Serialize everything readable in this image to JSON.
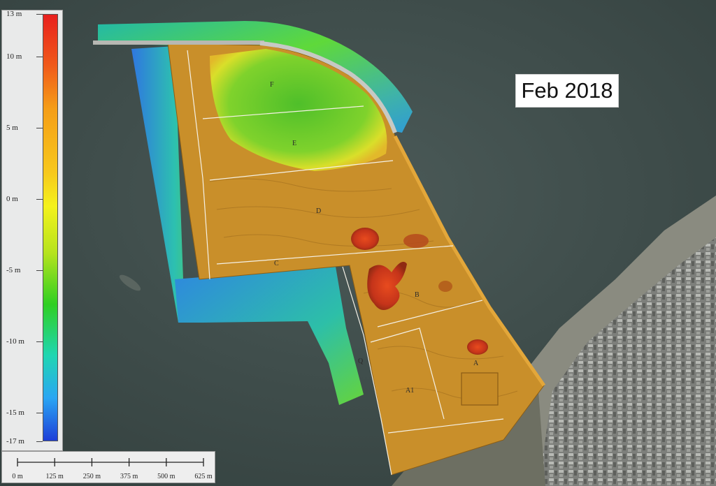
{
  "legend": {
    "title": "",
    "ticks": [
      {
        "label": "13 m",
        "value": 13
      },
      {
        "label": "10 m",
        "value": 10
      },
      {
        "label": "5 m",
        "value": 5
      },
      {
        "label": "0 m",
        "value": 0
      },
      {
        "label": "-5 m",
        "value": -5
      },
      {
        "label": "-10 m",
        "value": -10
      },
      {
        "label": "-15 m",
        "value": -15
      },
      {
        "label": "-17 m",
        "value": -17
      }
    ]
  },
  "date_label": "Feb 2018",
  "scale_bar": {
    "labels": [
      "0 m",
      "125 m",
      "250 m",
      "375 m",
      "500 m",
      "625 m"
    ]
  },
  "zones": [
    {
      "id": "F",
      "label": "F"
    },
    {
      "id": "E",
      "label": "E"
    },
    {
      "id": "D",
      "label": "D"
    },
    {
      "id": "C",
      "label": "C"
    },
    {
      "id": "B",
      "label": "B"
    },
    {
      "id": "A",
      "label": "A"
    },
    {
      "id": "A1",
      "label": "A1"
    },
    {
      "id": "Q",
      "label": "Q"
    }
  ],
  "colors": {
    "sea": "#3f4d4b",
    "reclaimed": "#c98f2a",
    "mound_high": "#c9341c",
    "mound_green": "#58c42a",
    "shore_blue": "#3d8fe0"
  }
}
